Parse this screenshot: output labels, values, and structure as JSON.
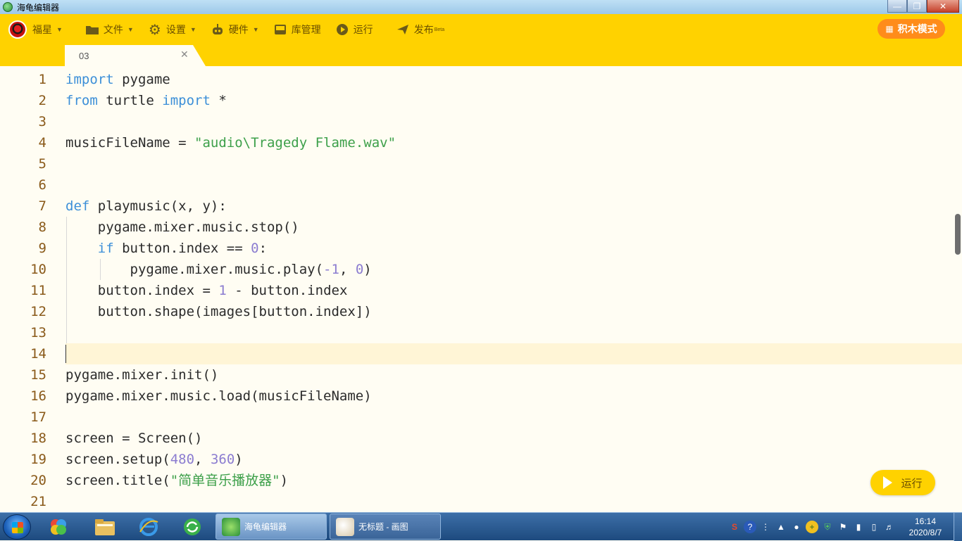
{
  "window": {
    "title": "海龟编辑器"
  },
  "toolbar": {
    "user": "福星",
    "file": "文件",
    "settings": "设置",
    "hardware": "硬件",
    "library": "库管理",
    "run": "运行",
    "publish": "发布",
    "publish_badge": "Beta",
    "block_mode": "积木模式"
  },
  "tabs": [
    {
      "label": "03"
    }
  ],
  "editor": {
    "line_numbers": [
      "1",
      "2",
      "3",
      "4",
      "5",
      "6",
      "7",
      "8",
      "9",
      "10",
      "11",
      "12",
      "13",
      "14",
      "15",
      "16",
      "17",
      "18",
      "19",
      "20",
      "21"
    ],
    "current_line": 14
  },
  "run_button": {
    "label": "运行"
  },
  "taskbar": {
    "tasks": [
      {
        "label": "海龟编辑器"
      },
      {
        "label": "无标题 - 画图"
      }
    ],
    "clock_time": "16:14",
    "clock_date": "2020/8/7"
  },
  "colors": {
    "toolbar_bg": "#ffd200",
    "editor_bg": "#fffdf3",
    "keyword": "#3c8fd8",
    "string": "#3da04a",
    "number": "#8b7cd0",
    "line_number": "#8a5a1a",
    "block_mode_bg": "#ff8c1a"
  }
}
